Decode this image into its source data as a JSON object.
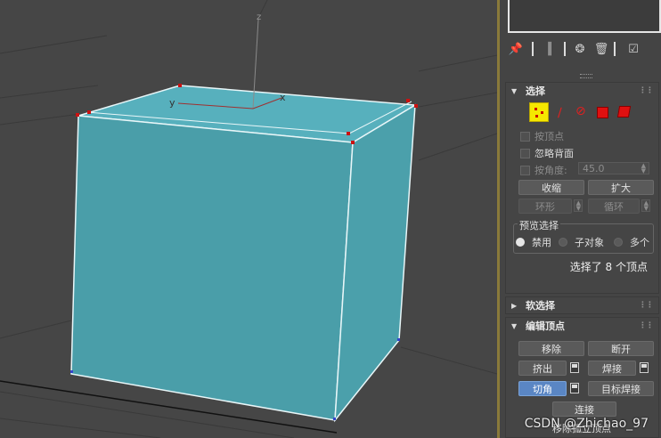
{
  "viewport": {
    "axis_labels": {
      "z": "z",
      "y": "y",
      "x": "x"
    },
    "box_color": "#4aa6b3",
    "vertex_color": "#cc1111"
  },
  "toolbar": {
    "icons": [
      "pin-icon",
      "stack-icon",
      "modifier-icon",
      "trash-icon",
      "configure-icon"
    ]
  },
  "selection": {
    "title": "选择",
    "vertex_check": "按顶点",
    "ignore_backface": "忽略背面",
    "by_angle": "按角度:",
    "angle_value": "45.0",
    "shrink": "收缩",
    "grow": "扩大",
    "ring": "环形",
    "loop": "循环",
    "preview_title": "预览选择",
    "preview_options": [
      "禁用",
      "子对象",
      "多个"
    ],
    "preview_selected": "禁用",
    "status": "选择了 8 个顶点"
  },
  "soft_selection": {
    "title": "软选择"
  },
  "edit_vertices": {
    "title": "编辑顶点",
    "remove": "移除",
    "break": "断开",
    "extrude": "挤出",
    "weld": "焊接",
    "chamfer": "切角",
    "target_weld": "目标焊接",
    "connect": "连接",
    "remove_isolated": "移除孤立顶点"
  },
  "watermark": "CSDN @Zhichao_97",
  "colors": {
    "accent": "#5a86c4",
    "panel_bg": "#454545",
    "viewport_bg": "#464646"
  }
}
